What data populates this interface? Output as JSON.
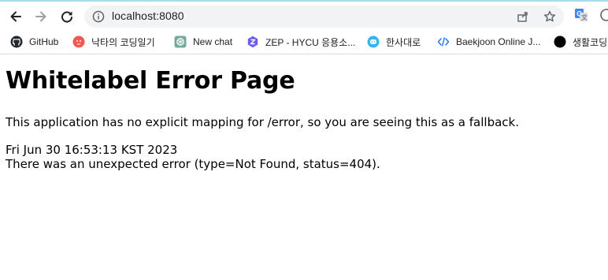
{
  "browser": {
    "address": "localhost:8080",
    "bookmarks": [
      {
        "label": "GitHub",
        "icon": "github-icon"
      },
      {
        "label": "낙타의 코딩일기",
        "icon": "camel-blog-icon"
      },
      {
        "label": "New chat",
        "icon": "chatgpt-icon"
      },
      {
        "label": "ZEP - HYCU 응용소...",
        "icon": "zep-icon"
      },
      {
        "label": "한사대로",
        "icon": "chat-bubble-icon"
      },
      {
        "label": "Baekjoon Online J...",
        "icon": "code-brackets-icon"
      },
      {
        "label": "생활코딩",
        "icon": "black-circle-icon"
      }
    ]
  },
  "page": {
    "title": "Whitelabel Error Page",
    "message": "This application has no explicit mapping for /error, so you are seeing this as a fallback.",
    "timestamp": "Fri Jun 30 16:53:13 KST 2023",
    "error_detail": "There was an unexpected error (type=Not Found, status=404)."
  },
  "colors": {
    "accent_top": "#a8dde8",
    "omnibox_bg": "#f1f3f4"
  }
}
